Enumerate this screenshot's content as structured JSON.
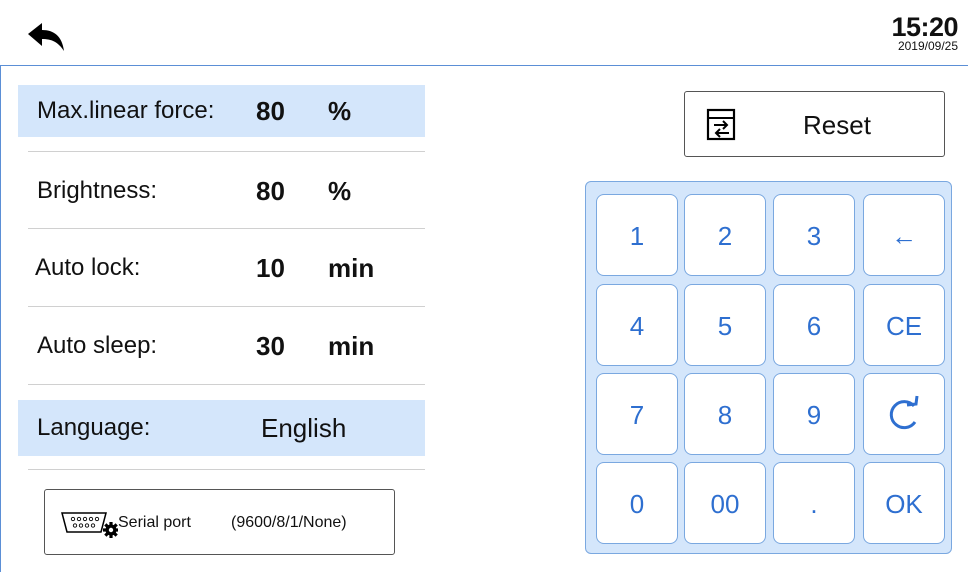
{
  "header": {
    "time": "15:20",
    "date": "2019/09/25"
  },
  "settings": [
    {
      "label": "Max.linear force:",
      "value": "80",
      "unit": "%",
      "highlighted": true
    },
    {
      "label": "Brightness:",
      "value": "80",
      "unit": "%",
      "highlighted": false
    },
    {
      "label": "Auto lock:",
      "value": "10",
      "unit": "min",
      "highlighted": false
    },
    {
      "label": "Auto sleep:",
      "value": "30",
      "unit": "min",
      "highlighted": false
    },
    {
      "label": "Language:",
      "value": "English",
      "unit": "",
      "highlighted": true
    }
  ],
  "serial": {
    "label": "Serial port",
    "params": "(9600/8/1/None)"
  },
  "reset": {
    "label": "Reset"
  },
  "keypad": {
    "keys": [
      "1",
      "2",
      "3",
      "←",
      "4",
      "5",
      "6",
      "CE",
      "7",
      "8",
      "9",
      "",
      "0",
      "00",
      ".",
      "OK"
    ],
    "icons": [
      "back-arrow-icon",
      "reset-icon",
      "serial-port-icon",
      "gear-icon",
      "refresh-icon"
    ]
  },
  "colors": {
    "accent": "#2e6fd0",
    "highlight": "#d4e6fb",
    "border": "#7aa8e0"
  }
}
